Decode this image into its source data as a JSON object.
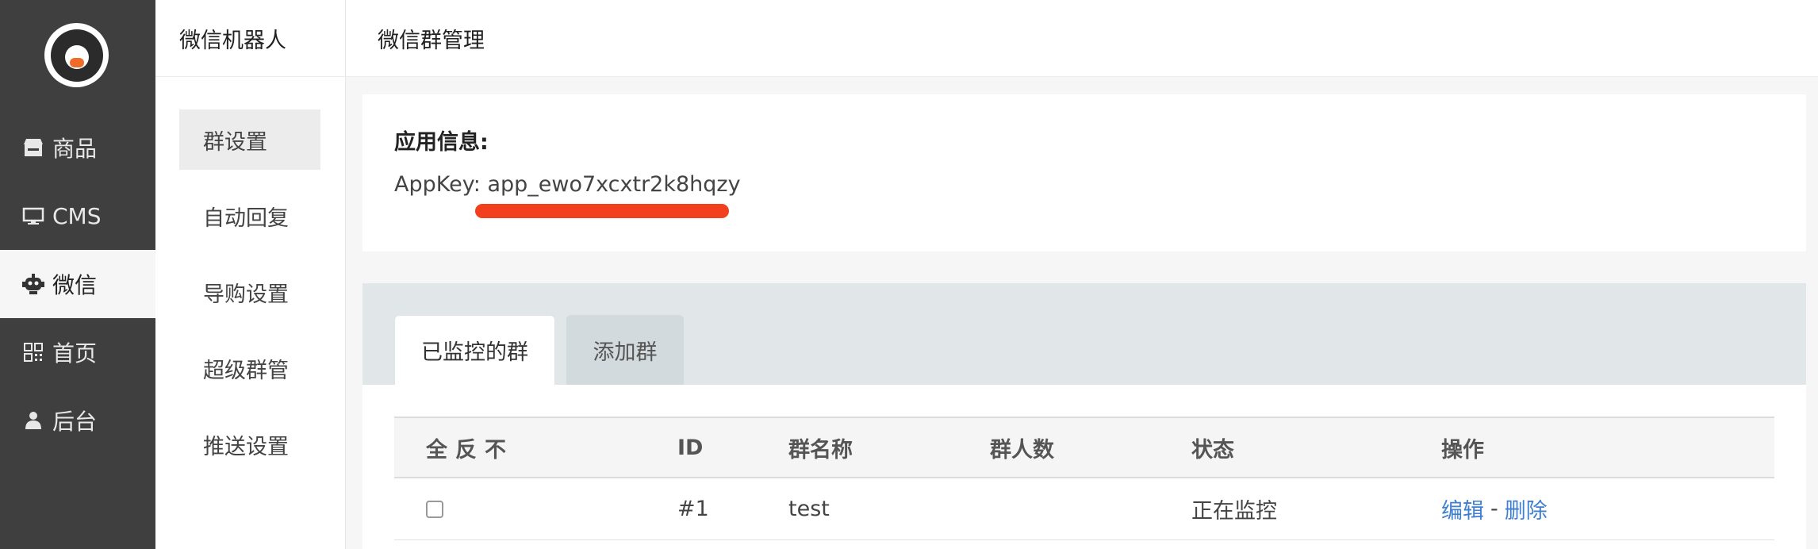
{
  "sidebar": {
    "logo": "pig-logo",
    "items": [
      {
        "label": "商品",
        "icon": "store-icon"
      },
      {
        "label": "CMS",
        "icon": "monitor-icon"
      },
      {
        "label": "微信",
        "icon": "robot-icon"
      },
      {
        "label": "首页",
        "icon": "qrcode-icon"
      },
      {
        "label": "后台",
        "icon": "user-icon"
      }
    ],
    "active_index": 2
  },
  "subnav": {
    "title": "微信机器人",
    "items": [
      "群设置",
      "自动回复",
      "导购设置",
      "超级群管",
      "推送设置"
    ],
    "active_index": 0
  },
  "header": {
    "title": "微信群管理"
  },
  "app_info": {
    "title": "应用信息:",
    "appkey_label": "AppKey:",
    "appkey_value": "app_ewo7xcxtr2k8hqzy",
    "highlight_color": "#f2401e"
  },
  "tabs": [
    {
      "label": "已监控的群",
      "active": true
    },
    {
      "label": "添加群",
      "active": false
    }
  ],
  "table": {
    "select_controls": [
      "全",
      "反",
      "不"
    ],
    "columns": [
      "ID",
      "群名称",
      "群人数",
      "状态",
      "操作"
    ],
    "rows": [
      {
        "id": "#1",
        "name": "test",
        "members": "",
        "status": "正在监控",
        "actions": [
          "编辑",
          "删除"
        ],
        "action_sep": "-"
      }
    ]
  },
  "colors": {
    "sidebar_bg": "#3f3f3f",
    "link": "#3e7fd1",
    "accent": "#f06a2a"
  }
}
